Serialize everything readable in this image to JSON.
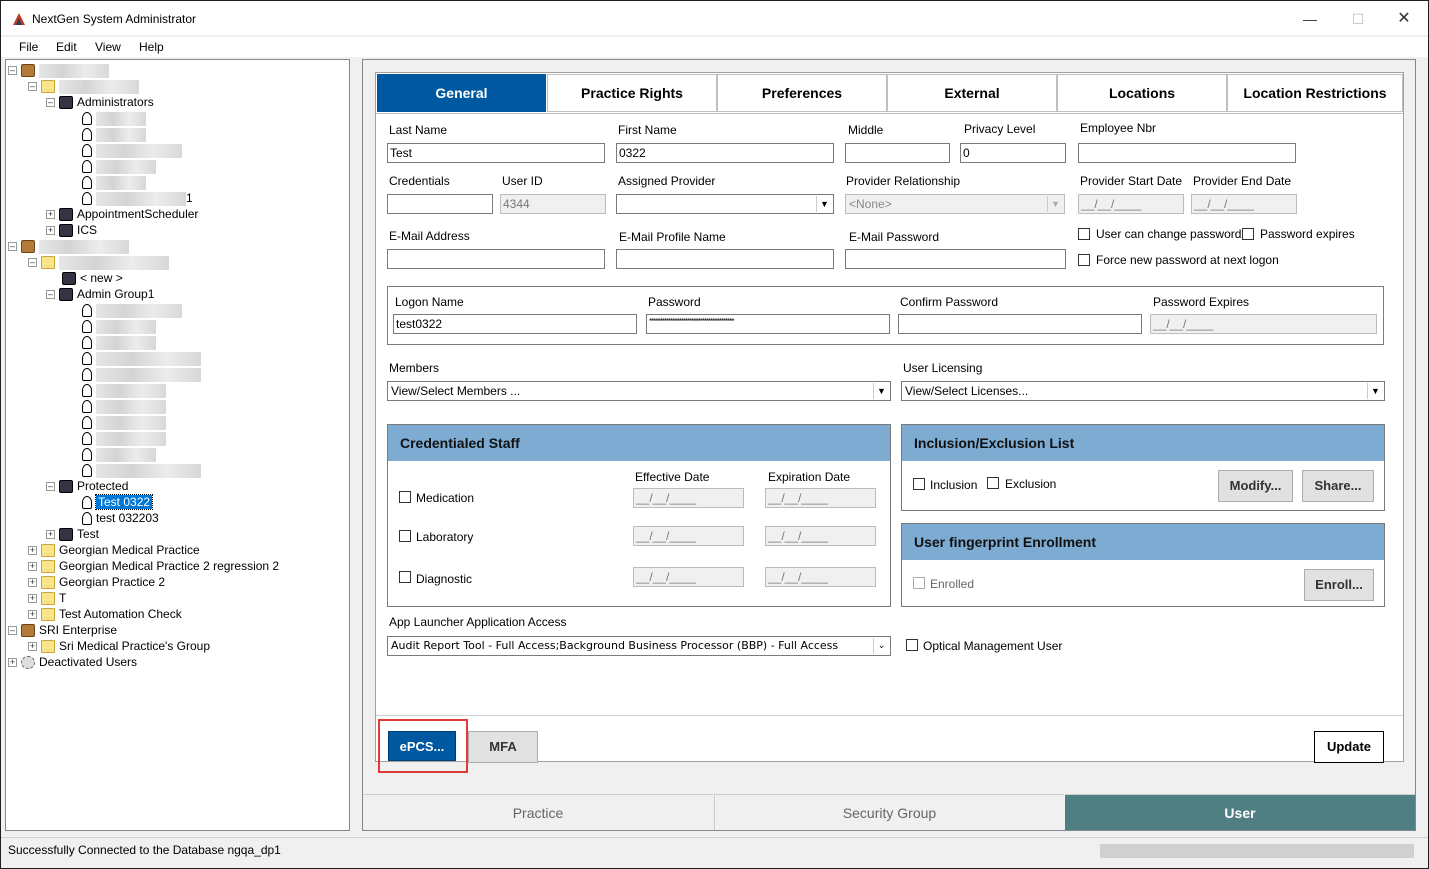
{
  "window": {
    "title": "NextGen System Administrator"
  },
  "menu": {
    "file": "File",
    "edit": "Edit",
    "view": "View",
    "help": "Help"
  },
  "tree": {
    "administrators": "Administrators",
    "appointment_scheduler": "AppointmentScheduler",
    "ics": "ICS",
    "new": "< new >",
    "admin_group1": "Admin Group1",
    "protected": "Protected",
    "test_0322": "Test 0322",
    "test_032203": "test 032203",
    "test": "Test",
    "georgian_medical_practice": "Georgian Medical Practice",
    "georgian_medical_practice_2": "Georgian Medical Practice 2 regression 2",
    "georgian_practice_2": "Georgian Practice 2",
    "t": "T",
    "test_automation_check": "Test Automation Check",
    "sri_enterprise": "SRI Enterprise",
    "sri_medical_group": "Sri Medical Practice's Group",
    "deactivated_users": "Deactivated Users",
    "partial_1": "1"
  },
  "tabs": {
    "general": "General",
    "practice_rights": "Practice Rights",
    "preferences": "Preferences",
    "external": "External",
    "locations": "Locations",
    "location_restrictions": "Location Restrictions"
  },
  "form": {
    "last_name_label": "Last Name",
    "last_name": "Test",
    "first_name_label": "First Name",
    "first_name": "0322",
    "middle_label": "Middle",
    "middle": "",
    "privacy_level_label": "Privacy Level",
    "privacy_level": "0",
    "employee_nbr_label": "Employee Nbr",
    "employee_nbr": "",
    "credentials_label": "Credentials",
    "credentials": "",
    "user_id_label": "User ID",
    "user_id": "4344",
    "assigned_provider_label": "Assigned Provider",
    "assigned_provider": "",
    "provider_relationship_label": "Provider Relationship",
    "provider_relationship": "<None>",
    "provider_start_label": "Provider Start Date",
    "provider_start": "__/__/____",
    "provider_end_label": "Provider End Date",
    "provider_end": "__/__/____",
    "email_label": "E-Mail Address",
    "email": "",
    "email_profile_label": "E-Mail Profile Name",
    "email_profile": "",
    "email_password_label": "E-Mail Password",
    "email_password": "",
    "user_can_change_pw": "User can change password",
    "password_expires_chk": "Password expires",
    "force_new_pw": "Force new password at next logon",
    "logon_name_label": "Logon Name",
    "logon_name": "test0322",
    "password_label": "Password",
    "password": "****************************************",
    "confirm_password_label": "Confirm Password",
    "confirm_password": "",
    "password_expires_label": "Password Expires",
    "password_expires": "__/__/____",
    "members_label": "Members",
    "members": "View/Select Members ...",
    "user_licensing_label": "User Licensing",
    "user_licensing": "View/Select Licenses...",
    "app_launcher_label": "App Launcher Application Access",
    "app_launcher": "Audit Report Tool - Full Access;Background Business Processor (BBP) - Full Access",
    "optical_mgmt": "Optical Management User"
  },
  "credentialed_staff": {
    "title": "Credentialed Staff",
    "effective_date": "Effective Date",
    "expiration_date": "Expiration Date",
    "medication": "Medication",
    "laboratory": "Laboratory",
    "diagnostic": "Diagnostic",
    "date_placeholder": "__/__/____"
  },
  "inclusion": {
    "title": "Inclusion/Exclusion List",
    "inclusion": "Inclusion",
    "exclusion": "Exclusion",
    "modify": "Modify...",
    "share": "Share..."
  },
  "fingerprint": {
    "title": "User fingerprint Enrollment",
    "enrolled": "Enrolled",
    "enroll": "Enroll..."
  },
  "actions": {
    "epcs": "ePCS...",
    "mfa": "MFA",
    "update": "Update"
  },
  "bottom_tabs": {
    "practice": "Practice",
    "security_group": "Security Group",
    "user": "User"
  },
  "status": {
    "text": "Successfully Connected to the Database ngqa_dp1"
  },
  "colors": {
    "accent": "#0058a0",
    "user_tab": "#4f7f82",
    "panel_head": "#7dabd2",
    "highlight": "#e03a3a"
  }
}
